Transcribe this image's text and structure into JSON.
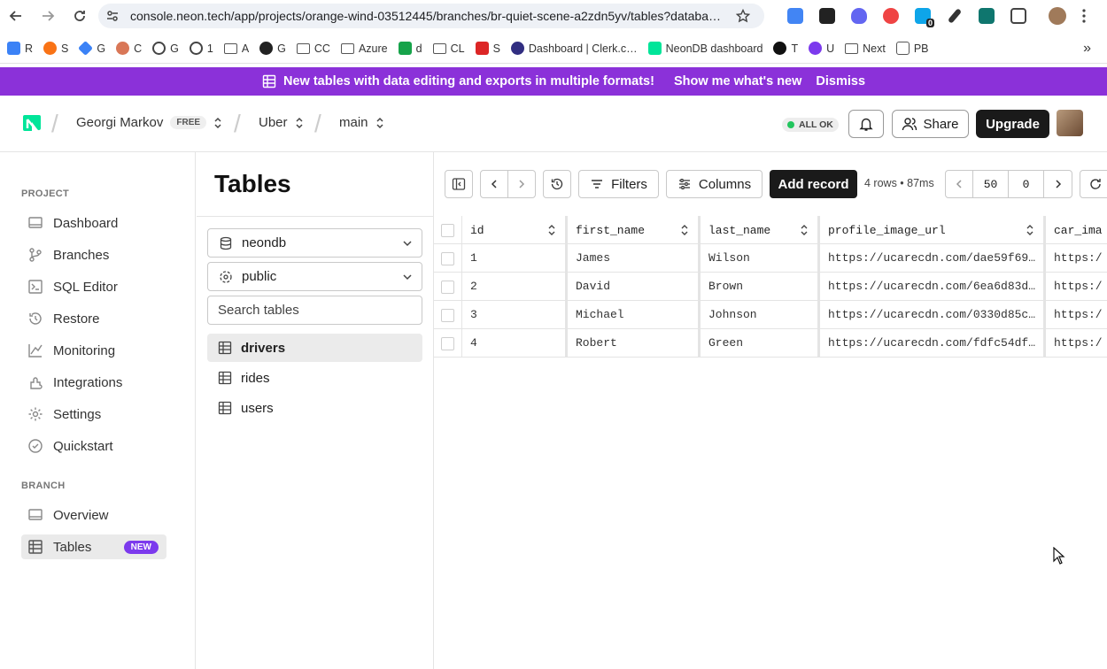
{
  "browser": {
    "url": "console.neon.tech/app/projects/orange-wind-03512445/branches/br-quiet-scene-a2zdn5yv/tables?databa…",
    "bookmarks": [
      "R",
      "S",
      "G",
      "C",
      "G",
      "1",
      "A",
      "G",
      "CC",
      "Azure",
      "d",
      "CL",
      "S",
      "Dashboard | Clerk.c…",
      "NeonDB dashboard",
      "T",
      "U",
      "Next",
      "PB"
    ],
    "ext_badge": "0"
  },
  "banner": {
    "text": "New tables with data editing and exports in multiple formats!",
    "show_me": "Show me what's new",
    "dismiss": "Dismiss"
  },
  "header": {
    "org": "Georgi Markov",
    "plan": "FREE",
    "project": "Uber",
    "branch": "main",
    "status": "ALL OK",
    "share": "Share",
    "upgrade": "Upgrade"
  },
  "sidebar": {
    "project_label": "PROJECT",
    "project_items": [
      {
        "label": "Dashboard",
        "icon": "dashboard-icon"
      },
      {
        "label": "Branches",
        "icon": "branches-icon"
      },
      {
        "label": "SQL Editor",
        "icon": "sql-editor-icon"
      },
      {
        "label": "Restore",
        "icon": "restore-icon"
      },
      {
        "label": "Monitoring",
        "icon": "monitoring-icon"
      },
      {
        "label": "Integrations",
        "icon": "integrations-icon"
      },
      {
        "label": "Settings",
        "icon": "gear-icon"
      },
      {
        "label": "Quickstart",
        "icon": "check-circle-icon"
      }
    ],
    "branch_label": "BRANCH",
    "branch_items": [
      {
        "label": "Overview",
        "icon": "overview-icon"
      },
      {
        "label": "Tables",
        "icon": "table-icon",
        "badge": "NEW"
      }
    ]
  },
  "tables_panel": {
    "title": "Tables",
    "database": "neondb",
    "schema": "public",
    "search_placeholder": "Search tables",
    "tables": [
      "drivers",
      "rides",
      "users"
    ]
  },
  "toolbar": {
    "filters": "Filters",
    "columns": "Columns",
    "add_record": "Add record",
    "row_info": "4 rows • 87ms",
    "limit": "50",
    "offset": "0"
  },
  "grid": {
    "columns": [
      "id",
      "first_name",
      "last_name",
      "profile_image_url",
      "car_ima"
    ],
    "rows": [
      [
        "1",
        "James",
        "Wilson",
        "https://ucarecdn.com/dae59f69…",
        "https:/"
      ],
      [
        "2",
        "David",
        "Brown",
        "https://ucarecdn.com/6ea6d83d…",
        "https:/"
      ],
      [
        "3",
        "Michael",
        "Johnson",
        "https://ucarecdn.com/0330d85c…",
        "https:/"
      ],
      [
        "4",
        "Robert",
        "Green",
        "https://ucarecdn.com/fdfc54df…",
        "https:/"
      ]
    ]
  },
  "colors": {
    "banner": "#8b31d9",
    "badge_new": "#7c3aed",
    "neon_logo": "#00e599",
    "status_ok": "#22c55e"
  }
}
